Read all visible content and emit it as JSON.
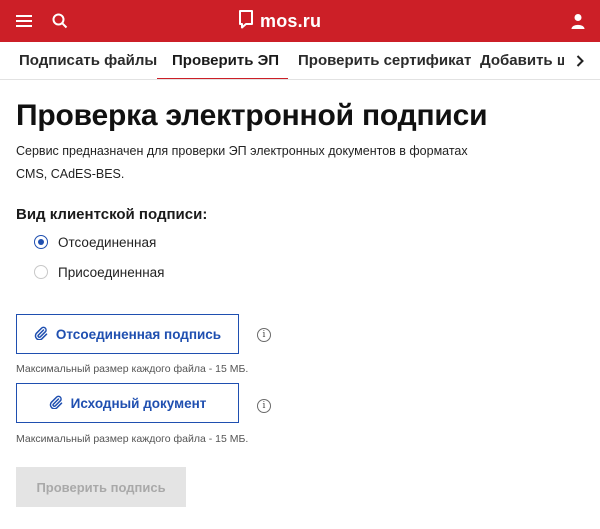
{
  "header": {
    "logo_text": "mos.ru",
    "menu_icon": "hamburger-icon",
    "search_icon": "search-icon",
    "user_icon": "user-icon",
    "brand_color": "#cc1f27"
  },
  "tabs": {
    "items": [
      {
        "label": "Подписать файлы"
      },
      {
        "label": "Проверить ЭП"
      },
      {
        "label": "Проверить сертификат"
      },
      {
        "label": "Добавить ш"
      }
    ],
    "active_index": 1
  },
  "page": {
    "title": "Проверка электронной подписи",
    "description": "Сервис предназначен для проверки ЭП электронных документов в форматах CMS, CAdES-BES."
  },
  "signature_type": {
    "label": "Вид клиентской подписи:",
    "options": [
      {
        "label": "Отсоединенная",
        "checked": true
      },
      {
        "label": "Присоединенная",
        "checked": false
      }
    ]
  },
  "uploads": {
    "detached": {
      "label": "Отсоединенная подпись",
      "hint": "Максимальный размер каждого файла - 15 МБ."
    },
    "source": {
      "label": "Исходный документ",
      "hint": "Максимальный размер каждого файла - 15 МБ."
    },
    "info_glyph": "i"
  },
  "submit": {
    "label": "Проверить подпись",
    "disabled": true
  },
  "colors": {
    "accent": "#1f4fb0",
    "disabled_bg": "#e4e4e4",
    "disabled_text": "#a9a9a9"
  }
}
